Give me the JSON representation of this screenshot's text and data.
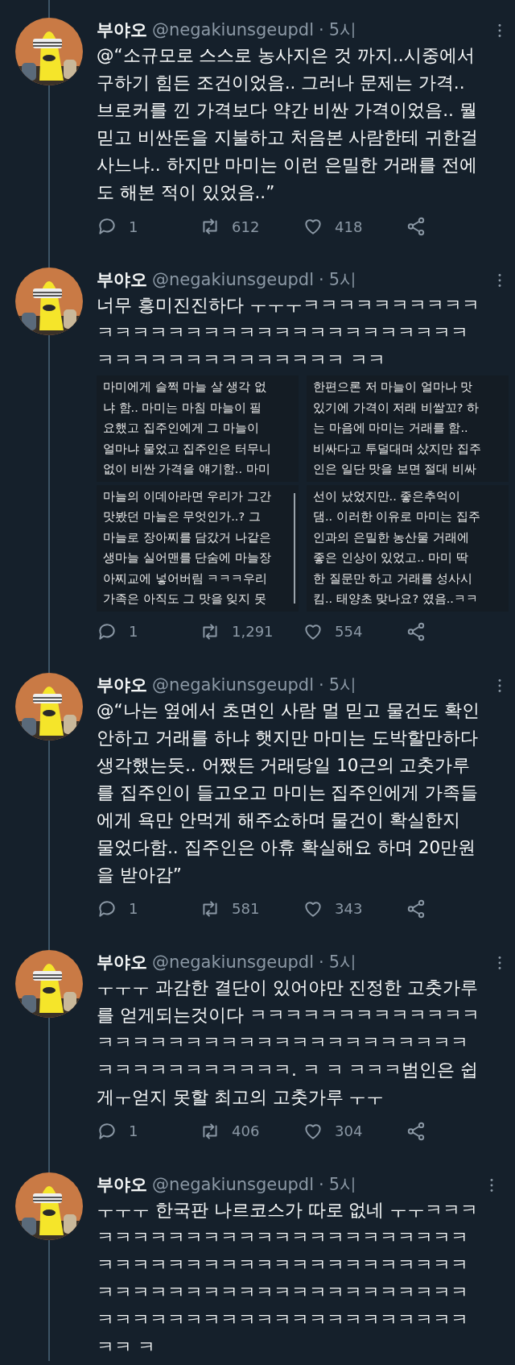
{
  "tweets": [
    {
      "author": "부야오",
      "handle": "@negakiunsgeupdl",
      "separator": "·",
      "time": "5시",
      "lines": [
        "@“소규모로 스스로 농사지은 것 까지..시중에서",
        "구하기 힘든 조건이었음.. 그러나 문제는 가격..",
        "브로커를 낀 가격보다 약간 비싼 가격이었음.. 뭘",
        "믿고 비싼돈을 지불하고 처음본 사람한테 귀한걸",
        "사느냐.. 하지만 마미는  이런 은밀한 거래를 전에",
        "도 해본 적이 있었음..”"
      ],
      "replies": "1",
      "retweets": "612",
      "likes": "418"
    },
    {
      "author": "부야오",
      "handle": "@negakiunsgeupdl",
      "separator": "·",
      "time": "5시",
      "lines": [
        "너무 흥미진진하다 ㅜㅜㅜㅋㅋㅋㅋㅋㅋㅋㅋㅋㅋ",
        "ㅋㅋㅋㅋㅋㅋㅋㅋㅋㅋㅋㅋㅋㅋㅋㅋㅋㅋㅋㅋㅋ",
        "ㅋㅋㅋㅋㅋㅋㅋㅋㅋㅋㅋㅋㅋㅋ ㅋㅋ"
      ],
      "media": {
        "panels": [
          {
            "sections": [
              {
                "scrollbar": false,
                "lines": [
                  "마미에게 슬쩍 마늘 살 생각 없",
                  "냐 함.. 마미는 마침 마늘이 필",
                  "요했고 집주인에게 그 마늘이",
                  "얼마냐 물었고 집주인은 터무니",
                  "없이 비싼 가격을 얘기함.. 마미"
                ]
              },
              {
                "scrollbar": true,
                "lines": [
                  "마늘의 이데아라면 우리가 그간",
                  "맛봤던 마늘은 무엇인가..? 그",
                  "마늘로 장아찌를 담갔거 나같은",
                  "생마늘 실어맨를 단숨에 마늘장",
                  "아찌교에 넣어버림 ㅋㅋㅋ우리",
                  "가족은 아직도 그 맛을 잊지 못"
                ]
              }
            ]
          },
          {
            "sections": [
              {
                "scrollbar": false,
                "lines": [
                  "한편으론 저 마늘이 얼마나 맛",
                  "있기에 가격이 저래 비쌀꼬? 하",
                  "는 마음에 마미는 거래를 함..",
                  "비싸다고 투덜대며 샀지만 집주",
                  "인은 일단 맛을 보면 절대 비싸"
                ]
              },
              {
                "scrollbar": false,
                "lines": [
                  "선이 났었지만.. 좋은추억이",
                  "댐.. 이러한 이유로 마미는 집주",
                  "인과의 은밀한 농산물 거래에",
                  "좋은 인상이 있었고.. 마미 딱",
                  "한 질문만 하고 거래를 성사시",
                  "킴.. 태양초 맞나요? 였음..ㅋㅋ"
                ]
              }
            ]
          }
        ]
      },
      "replies": "1",
      "retweets": "1,291",
      "likes": "554"
    },
    {
      "author": "부야오",
      "handle": "@negakiunsgeupdl",
      "separator": "·",
      "time": "5시",
      "lines": [
        "@“나는 옆에서 초면인 사람 멀 믿고 물건도 확인",
        "안하고 거래를 하냐 햇지만 마미는 도박할만하다",
        "생각했는듯.. 어쨌든 거래당일 10근의 고춧가루",
        "를 집주인이 들고오고 마미는 집주인에게 가족들",
        "에게 욕만 안먹게 해주쇼하며 물건이 확실한지",
        "물었다함.. 집주인은 아휴 확실해요 하며 20만원",
        "을 받아감”"
      ],
      "replies": "1",
      "retweets": "581",
      "likes": "343"
    },
    {
      "author": "부야오",
      "handle": "@negakiunsgeupdl",
      "separator": "·",
      "time": "5시",
      "lines": [
        "ㅜㅜㅜ 과감한 결단이 있어야만 진정한 고춧가루",
        "를 얻게되는것이다 ㅋㅋㅋㅋㅋㅋㅋㅋㅋㅋㅋㅋㅋ",
        "ㅋㅋㅋㅋㅋㅋㅋㅋㅋㅋㅋㅋㅋㅋㅋㅋㅋㅋㅋㅋㅋ",
        "ㅋㅋㅋㅋㅋㅋㅋㅋㅋㅋㅋ. ㅋ ㅋ ㅋㅋㅋ범인은 쉽",
        "게ㅜ얻지 못할 최고의 고춧가루 ㅜㅜ"
      ],
      "replies": "1",
      "retweets": "406",
      "likes": "304"
    },
    {
      "author": "부야오",
      "handle": "@negakiunsgeupdl",
      "separator": "·",
      "time": "5시",
      "lines": [
        "ㅜㅜㅜ 한국판 나르코스가 따로 없네 ㅜㅜㅋㅋㅋ",
        "ㅋㅋㅋㅋㅋㅋㅋㅋㅋㅋㅋㅋㅋㅋㅋㅋㅋㅋㅋㅋㅋ",
        "ㅋㅋㅋㅋㅋㅋㅋㅋㅋㅋㅋㅋㅋㅋㅋㅋㅋㅋㅋㅋㅋ",
        "ㅋㅋㅋㅋㅋㅋㅋㅋㅋㅋㅋㅋㅋㅋㅋㅋㅋㅋㅋㅋㅋ",
        "ㅋㅋㅋㅋㅋㅋㅋㅋㅋㅋㅋㅋㅋㅋㅋㅋㅋㅋㅋㅋㅋ",
        "ㅋㅋ ㅋ"
      ]
    }
  ]
}
